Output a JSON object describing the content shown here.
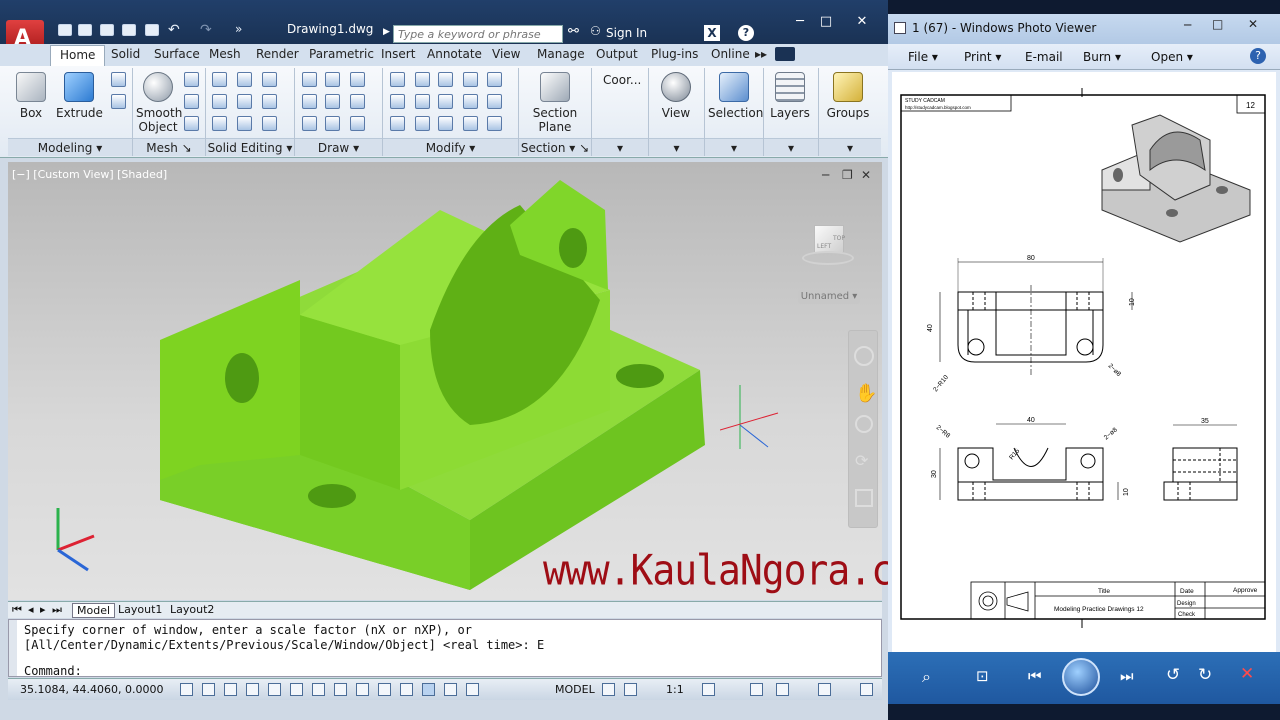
{
  "autocad": {
    "document_title": "Drawing1.dwg",
    "search_placeholder": "Type a keyword or phrase",
    "sign_in": "Sign In",
    "tabs": [
      "Home",
      "Solid",
      "Surface",
      "Mesh",
      "Render",
      "Parametric",
      "Insert",
      "Annotate",
      "View",
      "Manage",
      "Output",
      "Plug-ins",
      "Online"
    ],
    "buttons": {
      "box": "Box",
      "extrude": "Extrude",
      "smooth_object_1": "Smooth",
      "smooth_object_2": "Object",
      "section_plane_1": "Section",
      "section_plane_2": "Plane",
      "coordinates": "Coor...",
      "view": "View",
      "selection": "Selection",
      "layers": "Layers",
      "groups": "Groups"
    },
    "panels": [
      "Modeling",
      "Mesh",
      "Solid Editing",
      "Draw",
      "Modify",
      "Section"
    ],
    "viewport_label": "[−] [Custom View] [Shaded]",
    "viewcube_label": "Unnamed",
    "viewcube_faces": {
      "top": "TOP",
      "left": "LEFT"
    },
    "layout_tabs": [
      "Model",
      "Layout1",
      "Layout2"
    ],
    "command_lines": [
      "Specify corner of window, enter a scale factor (nX or nXP), or",
      "[All/Center/Dynamic/Extents/Previous/Scale/Window/Object] <real time>: E",
      "Command:"
    ],
    "coordinates": "35.1084, 44.4060, 0.0000",
    "status_model": "MODEL",
    "status_scale": "1:1",
    "colors": {
      "solid_green": "#7ed321",
      "ribbon_dark": "#1a3254"
    }
  },
  "watermark": "www.KaulaNgora.com",
  "photo_viewer": {
    "title": "1 (67) - Windows Photo Viewer",
    "menu": [
      "File",
      "Print",
      "E-mail",
      "Burn",
      "Open"
    ],
    "drawing": {
      "header": "STUDY CADCAM",
      "url": "http://studycadcam.blogspot.com",
      "sheet_number": "12",
      "dims": {
        "top_width": "80",
        "top_height": "40",
        "top_depth": "10",
        "hole_r": "2−R10",
        "hole_d": "2−ø8",
        "front_width": "40",
        "front_r": "R15",
        "front_hole_d": "2−ø8",
        "front_hole_r": "2−R8",
        "front_height": "30",
        "front_base": "10",
        "side_width": "35"
      },
      "title_block": {
        "title_label": "Title",
        "title": "Modeling Practice Drawings 12",
        "date": "Date",
        "approve": "Approve",
        "design": "Design",
        "check": "Check"
      }
    }
  }
}
